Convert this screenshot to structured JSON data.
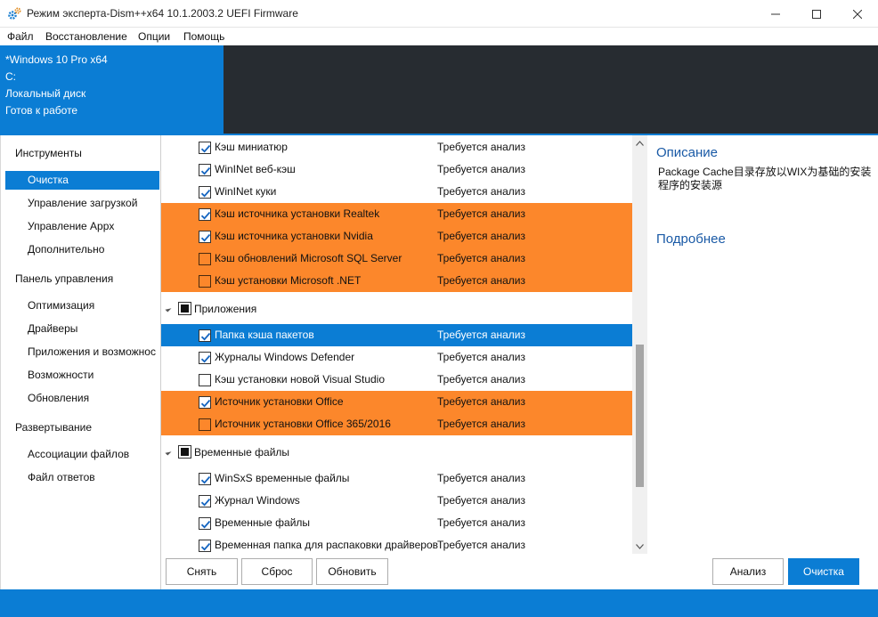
{
  "window": {
    "title": "Режим эксперта-Dism++x64 10.1.2003.2 UEFI Firmware",
    "app_icon": "gears-icon",
    "controls": [
      "minimize-icon",
      "maximize-icon",
      "close-icon"
    ]
  },
  "menu": [
    "Файл",
    "Восстановление",
    "Опции",
    "Помощь"
  ],
  "info": {
    "os": "*Windows 10 Pro x64",
    "drive": "C:",
    "disk": "Локальный диск",
    "status": "Готов к работе"
  },
  "nav": {
    "sections": [
      {
        "label": "Инструменты",
        "items": [
          "Очистка",
          "Управление загрузкой",
          "Управление Appx",
          "Дополнительно"
        ]
      },
      {
        "label": "Панель управления",
        "items": [
          "Оптимизация",
          "Драйверы",
          "Приложения и возможнос",
          "Возможности",
          "Обновления"
        ]
      },
      {
        "label": "Развертывание",
        "items": [
          "Ассоциации файлов",
          "Файл ответов"
        ]
      }
    ],
    "selected": "Очистка"
  },
  "list": {
    "status_text": "Требуется анализ",
    "rows": [
      {
        "name": "Кэш миниатюр",
        "checked": true,
        "style": "normal"
      },
      {
        "name": "WinINet веб-кэш",
        "checked": true,
        "style": "normal"
      },
      {
        "name": "WinINet куки",
        "checked": true,
        "style": "normal"
      },
      {
        "name": "Кэш источника установки Realtek",
        "checked": true,
        "style": "orange"
      },
      {
        "name": "Кэш источника установки Nvidia",
        "checked": true,
        "style": "orange"
      },
      {
        "name": "Кэш обновлений Microsoft SQL Server",
        "checked": false,
        "style": "orange"
      },
      {
        "name": "Кэш установки Microsoft .NET",
        "checked": false,
        "style": "orange"
      }
    ],
    "group_apps": "Приложения",
    "rows_apps": [
      {
        "name": "Папка кэша пакетов",
        "checked": true,
        "style": "blue"
      },
      {
        "name": "Журналы Windows Defender",
        "checked": true,
        "style": "normal"
      },
      {
        "name": "Кэш установки новой Visual Studio",
        "checked": false,
        "style": "normal"
      },
      {
        "name": "Источник установки Office",
        "checked": true,
        "style": "orange"
      },
      {
        "name": "Источник установки Office 365/2016",
        "checked": false,
        "style": "orange"
      }
    ],
    "group_temp": "Временные файлы",
    "rows_temp": [
      {
        "name": "WinSxS временные файлы",
        "checked": true,
        "style": "normal"
      },
      {
        "name": "Журнал Windows",
        "checked": true,
        "style": "normal"
      },
      {
        "name": "Временные файлы",
        "checked": true,
        "style": "normal"
      },
      {
        "name": "Временная папка для распаковки драйверов",
        "checked": true,
        "style": "normal"
      }
    ]
  },
  "description": {
    "title": "Описание",
    "text": "Package Cache目录存放以WIX为基础的安装程序的安装源",
    "more": "Подробнее"
  },
  "buttons": {
    "remove": "Снять",
    "reset": "Сброс",
    "refresh": "Обновить",
    "analyze": "Анализ",
    "clean": "Очистка"
  },
  "colors": {
    "accent": "#0b7dd4",
    "highlight_orange": "#fc872b",
    "dark_panel": "#272c31"
  }
}
